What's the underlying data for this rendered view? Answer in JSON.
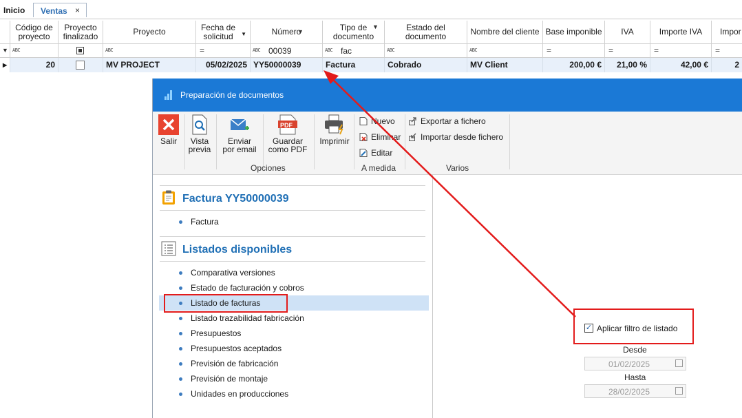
{
  "tabs": {
    "home": "Inicio",
    "active": "Ventas",
    "close": "×"
  },
  "grid": {
    "headers": {
      "codigo": "Código de proyecto",
      "finalizado": "Proyecto finalizado",
      "proyecto": "Proyecto",
      "fecha": "Fecha de solicitud",
      "numero": "Número",
      "tipo": "Tipo de documento",
      "estado": "Estado del documento",
      "cliente": "Nombre del cliente",
      "base": "Base imponible",
      "iva": "IVA",
      "importe_iva": "Importe IVA",
      "importe_cut": "Impor"
    },
    "filters": {
      "numero": "00039",
      "tipo": "fac",
      "abc_icon": "abc-filter-icon",
      "eq_icon": "="
    },
    "row": {
      "codigo": "20",
      "proyecto": "MV PROJECT",
      "fecha": "05/02/2025",
      "numero": "YY50000039",
      "tipo": "Factura",
      "estado": "Cobrado",
      "cliente": "MV Client",
      "base": "200,00 €",
      "iva": "21,00 %",
      "importe_iva": "42,00 €",
      "importe_cut": "2"
    }
  },
  "dialog": {
    "title": "Preparación de documentos",
    "ribbon": {
      "salir": "Salir",
      "vista_previa": [
        "Vista",
        "previa"
      ],
      "enviar_email": [
        "Enviar",
        "por email"
      ],
      "guardar_pdf": [
        "Guardar",
        "como PDF"
      ],
      "imprimir": "Imprimir",
      "group_opciones": "Opciones",
      "nuevo": "Nuevo",
      "eliminar": "Eliminar",
      "editar": "Editar",
      "group_a_medida": "A medida",
      "exportar": "Exportar a fichero",
      "importar": "Importar desde fichero",
      "group_varios": "Varios",
      "pdf_badge": "PDF"
    },
    "invoice_section": {
      "title": "Factura YY50000039",
      "items": [
        "Factura"
      ]
    },
    "listados_section": {
      "title": "Listados disponibles",
      "items": [
        "Comparativa versiones",
        "Estado de facturación y cobros",
        "Listado de facturas",
        "Listado trazabilidad fabricación",
        "Presupuestos",
        "Presupuestos aceptados",
        "Previsión de fabricación",
        "Previsión de montaje",
        "Unidades en producciones"
      ],
      "selected_index": 2
    },
    "filter": {
      "apply_label": "Aplicar filtro de listado",
      "checked": true,
      "desde_label": "Desde",
      "desde_value": "01/02/2025",
      "hasta_label": "Hasta",
      "hasta_value": "28/02/2025"
    }
  },
  "colors": {
    "accent": "#1b79d6",
    "title_blue": "#1f6fb5",
    "highlight_red": "#e31b1b",
    "selected_row": "#cfe2f6"
  }
}
